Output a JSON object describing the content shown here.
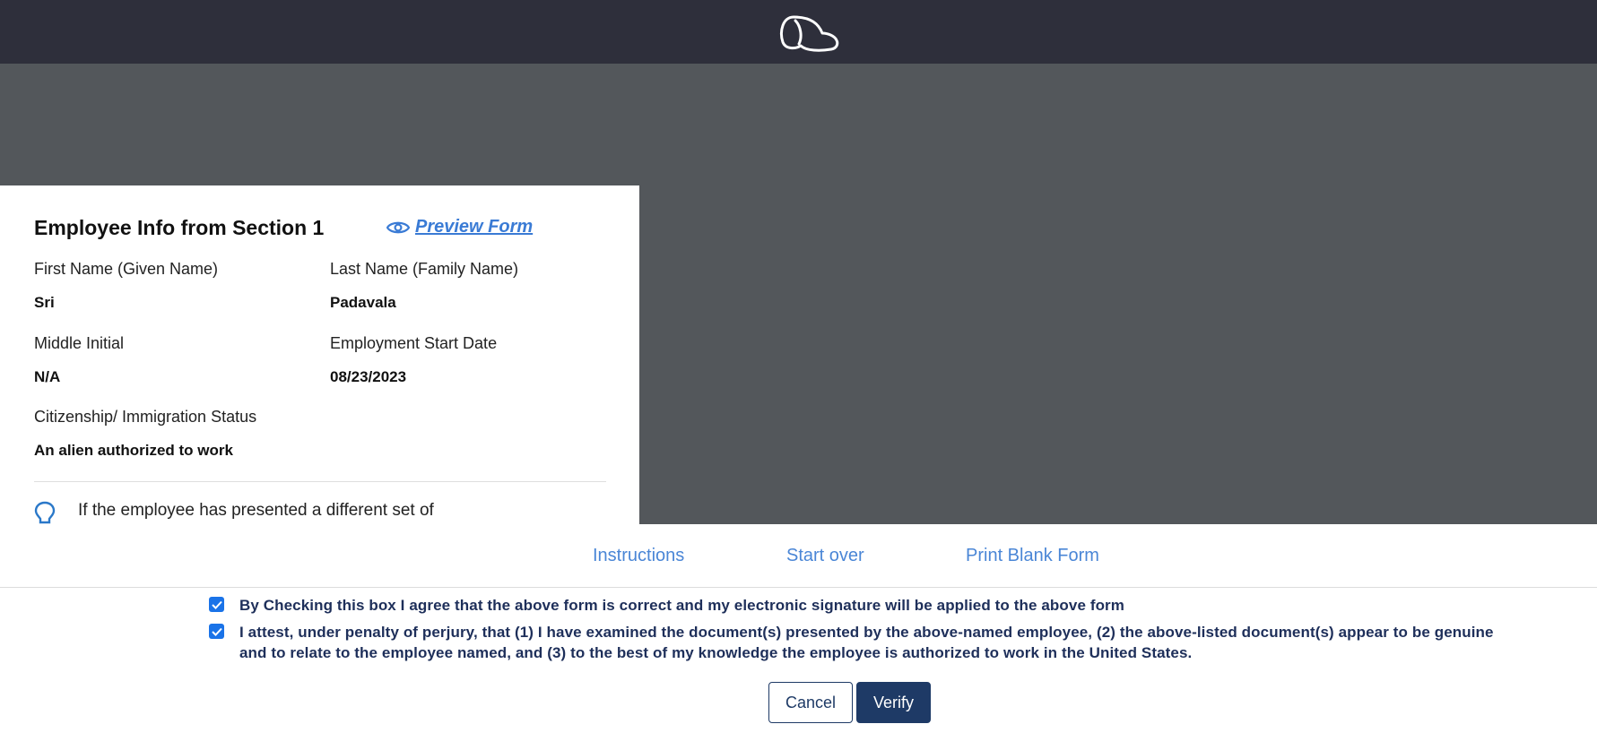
{
  "header": {
    "logo_icon": "head-outline-logo-icon"
  },
  "section1": {
    "title": "Employee Info from Section 1",
    "preview_link": "Preview Form",
    "preview_icon": "eye-icon",
    "fields": {
      "first_name_label": "First Name (Given Name)",
      "first_name_value": "Sri",
      "last_name_label": "Last Name (Family Name)",
      "last_name_value": "Padavala",
      "middle_initial_label": "Middle Initial",
      "middle_initial_value": "N/A",
      "start_date_label": "Employment Start Date",
      "start_date_value": "08/23/2023",
      "status_label": "Citizenship/ Immigration Status",
      "status_value": "An alien authorized to work"
    },
    "tip_icon": "lightbulb-icon",
    "tip_text": "If the employee has presented a different set of"
  },
  "links": {
    "instructions": "Instructions",
    "start_over": "Start over",
    "print_blank": "Print Blank Form"
  },
  "agreement": {
    "checkbox1_checked": true,
    "checkbox1_text": "By Checking this box I agree that the above form is correct and my electronic signature will be applied to the above form",
    "checkbox2_checked": true,
    "checkbox2_text_line1": "I attest, under penalty of perjury, that (1) I have examined the document(s) presented by the above-named employee, (2) the above-listed document(s) appear to be genuine",
    "checkbox2_text_line2": "and to relate to the employee named, and (3) to the best of my knowledge the employee is authorized to work in the United States."
  },
  "buttons": {
    "cancel": "Cancel",
    "verify": "Verify"
  },
  "colors": {
    "topbar": "#2e2f3b",
    "overlay": "#53575b",
    "link": "#4a86d6",
    "primary": "#1e3a66",
    "checkbox": "#1a73e8"
  }
}
